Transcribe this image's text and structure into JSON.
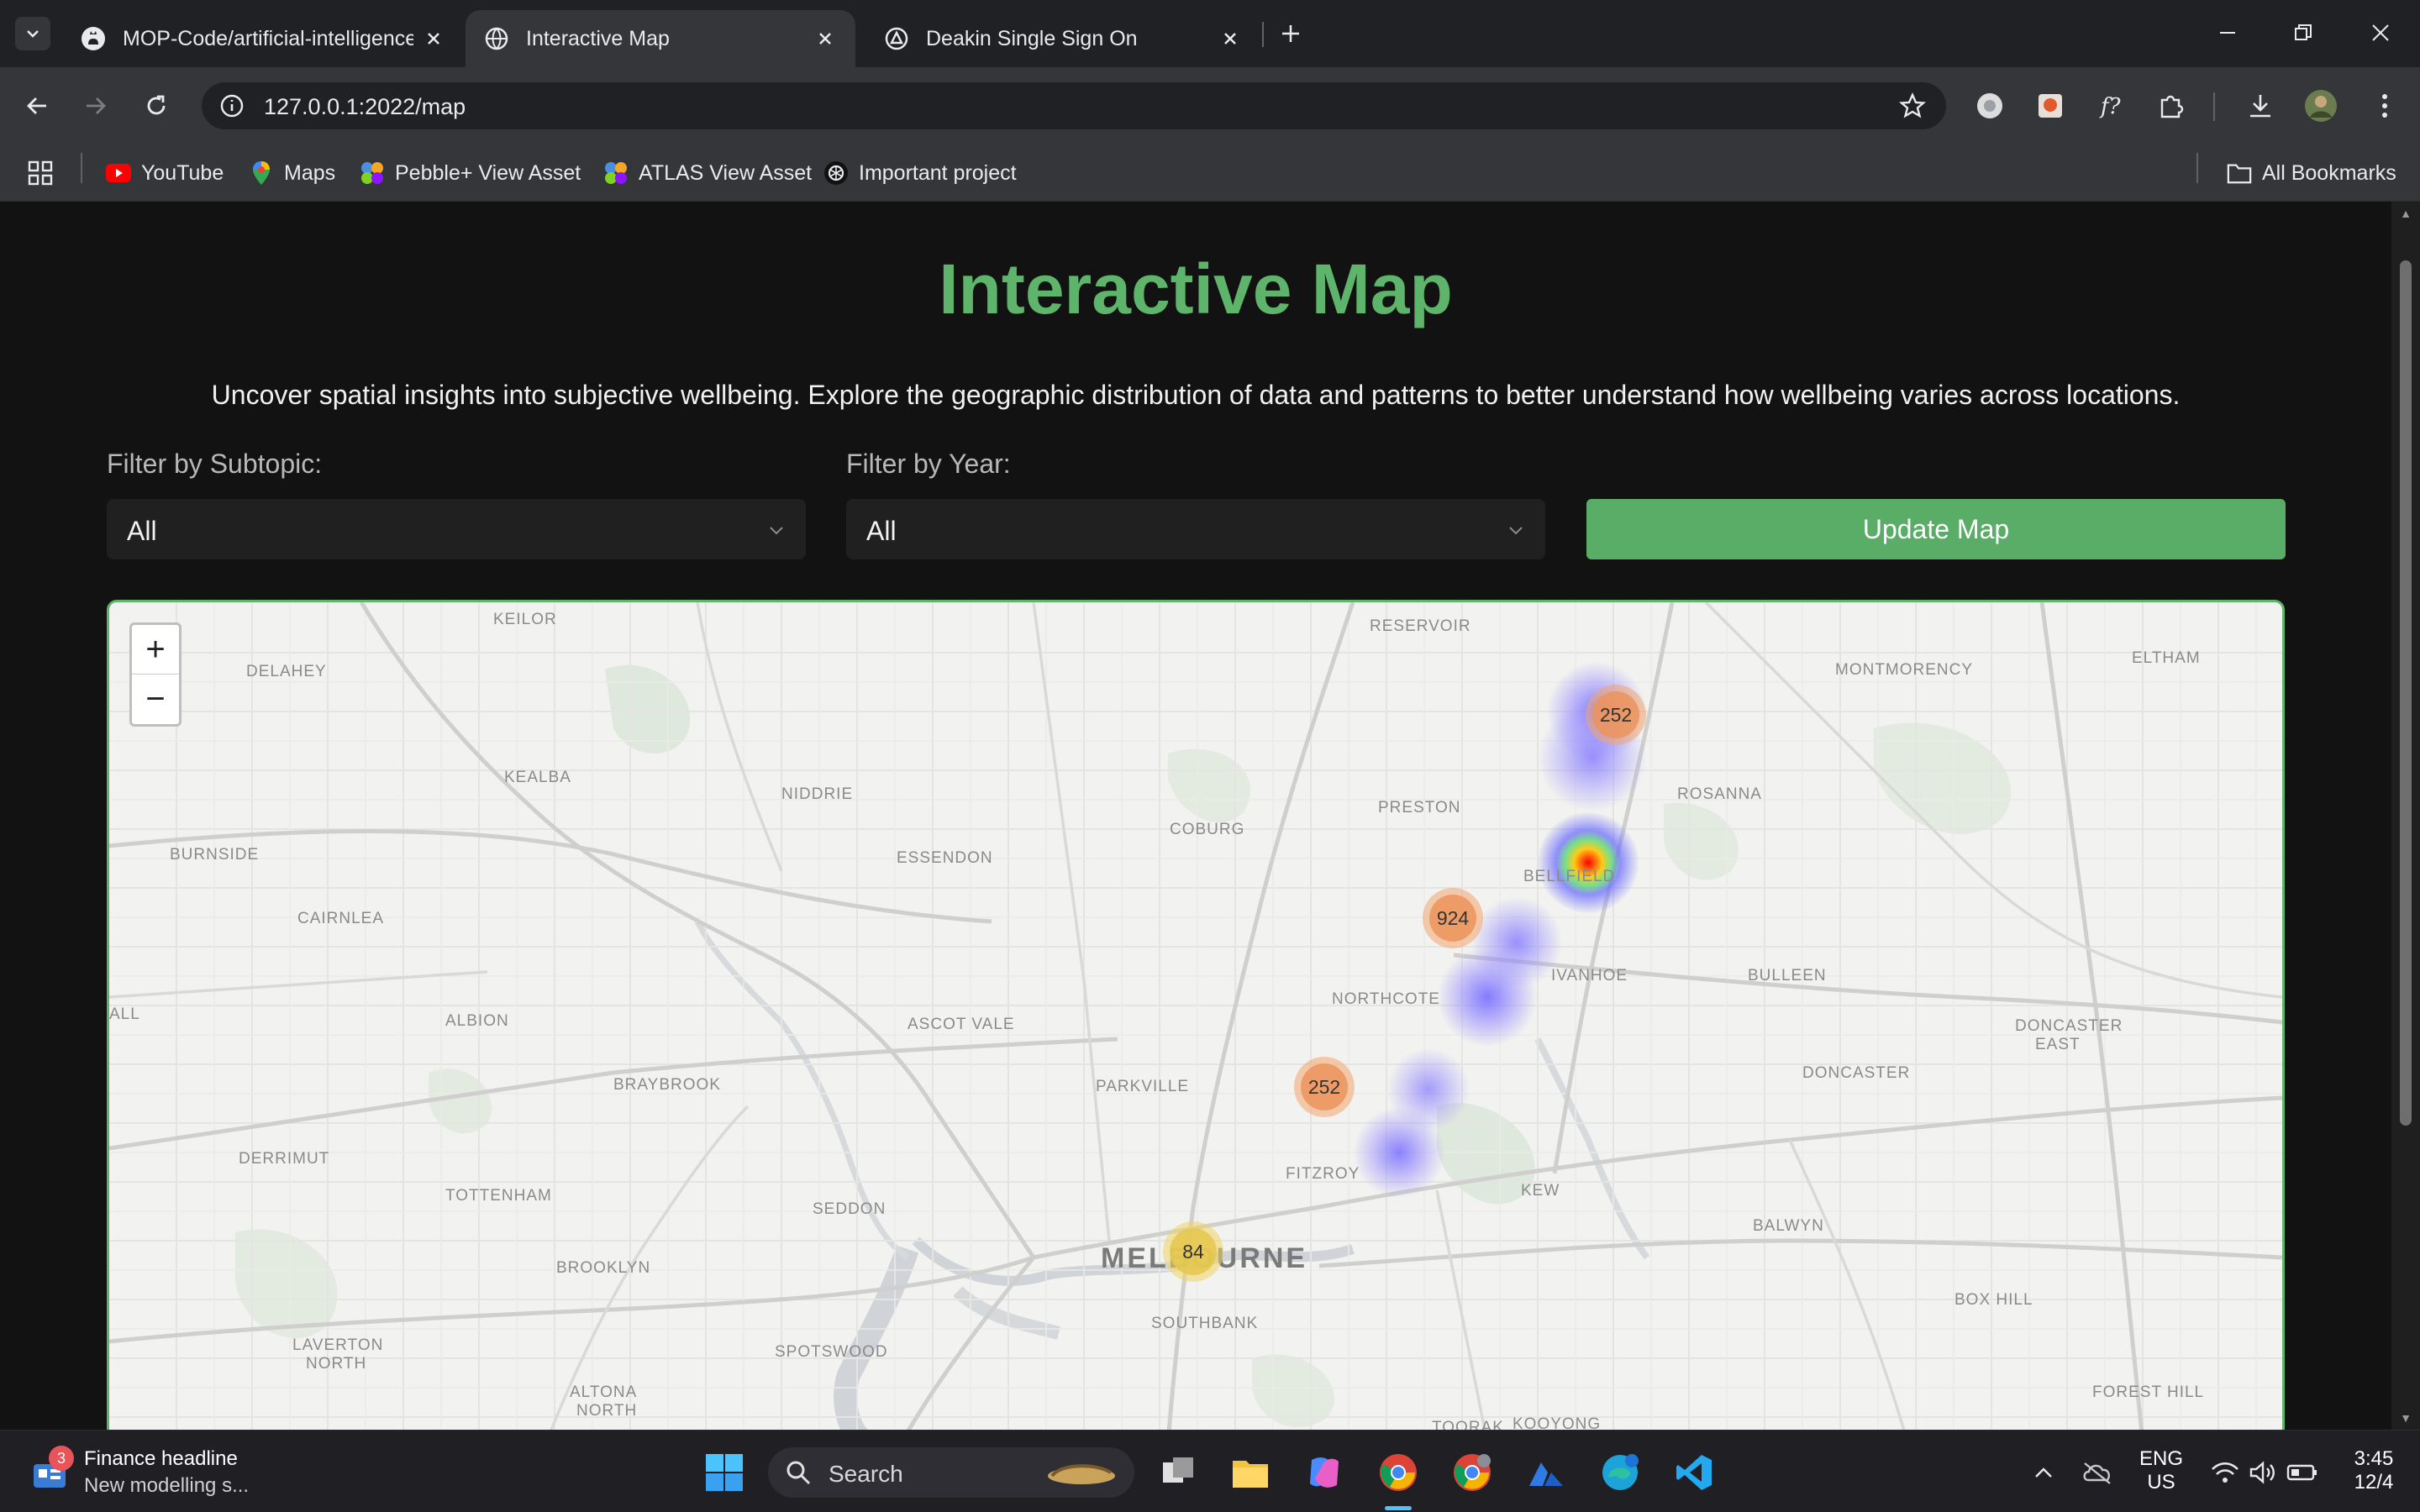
{
  "browser": {
    "tabs": [
      {
        "title": "MOP-Code/artificial-intelligence",
        "active": false
      },
      {
        "title": "Interactive Map",
        "active": true
      },
      {
        "title": "Deakin Single Sign On",
        "active": false
      }
    ],
    "url": "127.0.0.1:2022/map",
    "bookmarks": [
      {
        "label": "YouTube",
        "icon": "youtube-icon"
      },
      {
        "label": "Maps",
        "icon": "maps-pin-icon"
      },
      {
        "label": "Pebble+ View Asset",
        "icon": "pebble-icon"
      },
      {
        "label": "ATLAS View Asset",
        "icon": "atlas-icon"
      },
      {
        "label": "Important project",
        "icon": "openai-icon"
      }
    ],
    "all_bookmarks_label": "All Bookmarks"
  },
  "page": {
    "title": "Interactive Map",
    "description": "Uncover spatial insights into subjective wellbeing. Explore the geographic distribution of data and patterns to better understand how wellbeing varies across locations.",
    "filters": {
      "subtopic_label": "Filter by Subtopic:",
      "subtopic_value": "All",
      "year_label": "Filter by Year:",
      "year_value": "All"
    },
    "update_button": "Update Map"
  },
  "map": {
    "zoom_in": "+",
    "zoom_out": "−",
    "places": {
      "keilor": "KEILOR",
      "reservoir": "RESERVOIR",
      "montmorency": "MONTMORENCY",
      "eltham": "ELTHAM",
      "delahey": "DELAHEY",
      "kealba": "KEALBA",
      "niddrie": "NIDDRIE",
      "preston": "PRESTON",
      "rosanna": "ROSANNA",
      "burnside": "BURNSIDE",
      "essendon": "ESSENDON",
      "coburg": "COBURG",
      "bellfield": "BELLFIELD",
      "cairnlea": "CAIRNLEA",
      "ivanhoe": "IVANHOE",
      "bulleen": "BULLEEN",
      "albion": "ALBION",
      "ascot_vale": "ASCOT VALE",
      "northcote": "NORTHCOTE",
      "doncaster_east_1": "DONCASTER",
      "doncaster_east_2": "EAST",
      "braybrook": "BRAYBROOK",
      "parkville": "PARKVILLE",
      "doncaster": "DONCASTER",
      "derrimut": "DERRIMUT",
      "fitzroy": "FITZROY",
      "tottenham": "TOTTENHAM",
      "kew": "KEW",
      "seddon": "SEDDON",
      "balwyn": "BALWYN",
      "melbourne": "MELBOURNE",
      "brooklyn": "BROOKLYN",
      "southbank": "SOUTHBANK",
      "box_hill": "BOX HILL",
      "laverton_north_1": "LAVERTON",
      "laverton_north_2": "NORTH",
      "spotswood": "SPOTSWOOD",
      "altona_north_1": "ALTONA",
      "altona_north_2": "NORTH",
      "toorak": "TOORAK",
      "kooyong": "KOOYONG",
      "forest_hill": "FOREST HILL",
      "all_edge": "ALL"
    },
    "clusters": [
      {
        "id": "reservoir",
        "count": "252",
        "color": "#ec945c"
      },
      {
        "id": "bellfield",
        "count": "924",
        "color": "#ec945c"
      },
      {
        "id": "fitzroy-north",
        "count": "252",
        "color": "#ec945c"
      },
      {
        "id": "melbourne-cbd",
        "count": "84",
        "color": "#e6c850"
      }
    ],
    "colors": {
      "land": "#f2f2f0",
      "border": "#5db46a",
      "heat_low": "#7b6cf0",
      "heat_high": "#ff2a1a"
    }
  },
  "taskbar": {
    "news_title": "Finance headline",
    "news_sub": "New modelling s...",
    "news_badge": "3",
    "search_placeholder": "Search",
    "lang_1": "ENG",
    "lang_2": "US",
    "time": "3:45",
    "date": "12/4"
  }
}
